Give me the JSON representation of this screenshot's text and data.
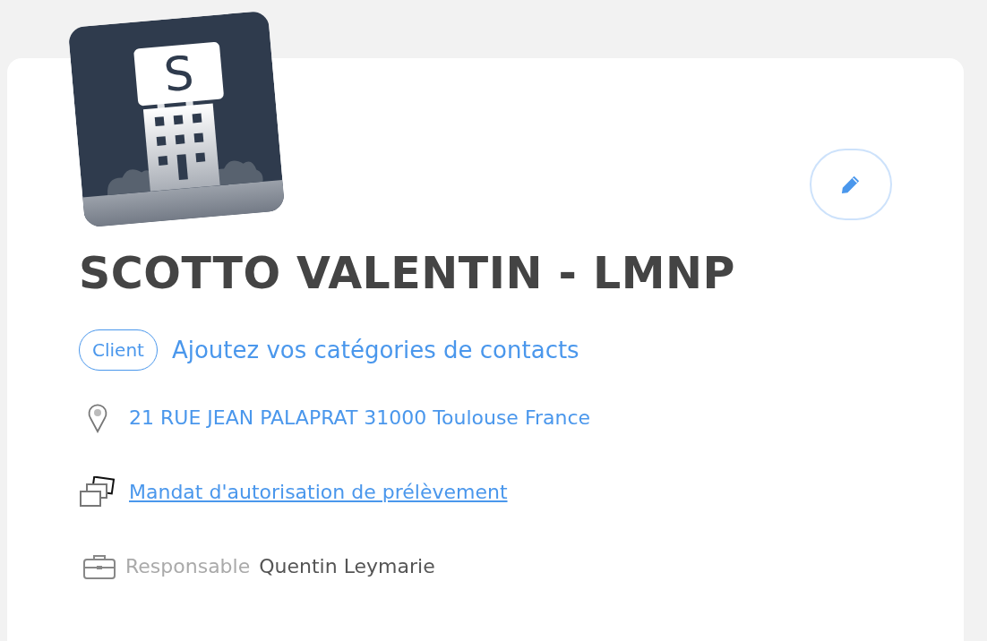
{
  "logo": {
    "letter": "S"
  },
  "title": "SCOTTO VALENTIN - LMNP",
  "tags": [
    {
      "label": "Client"
    }
  ],
  "add_categories_link": "Ajoutez vos catégories de contacts",
  "address": "21 RUE JEAN PALAPRAT 31000 Toulouse France",
  "mandate_link": "Mandat d'autorisation de prélèvement",
  "manager": {
    "label": "Responsable",
    "name": "Quentin Leymarie"
  }
}
